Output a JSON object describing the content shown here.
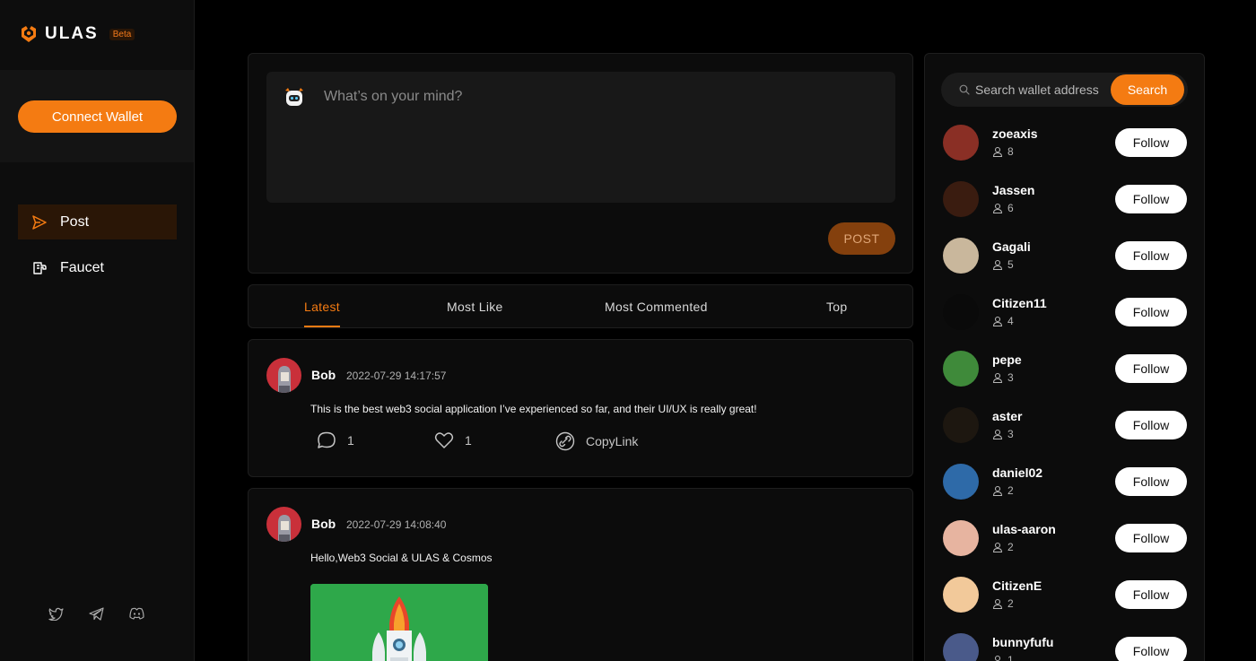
{
  "brand": {
    "name": "ULAS",
    "badge": "Beta",
    "accent": "#f47b12"
  },
  "sidebar": {
    "connect_label": "Connect Wallet",
    "nav": [
      {
        "label": "Post",
        "icon": "send-icon",
        "active": true
      },
      {
        "label": "Faucet",
        "icon": "faucet-icon",
        "active": false
      }
    ],
    "socials": [
      "twitter-icon",
      "telegram-icon",
      "discord-icon"
    ]
  },
  "composer": {
    "placeholder": "What’s on your mind?",
    "post_label": "POST"
  },
  "tabs": [
    "Latest",
    "Most Like",
    "Most Commented",
    "Top"
  ],
  "posts": [
    {
      "author": "Bob",
      "time": "2022-07-29 14:17:57",
      "text": "This is the best web3 social application I’ve experienced so far, and their UI/UX is really great!",
      "comments": "1",
      "likes": "1",
      "copy_label": "CopyLink"
    },
    {
      "author": "Bob",
      "time": "2022-07-29 14:08:40",
      "text": "Hello,Web3 Social & ULAS & Cosmos"
    }
  ],
  "search": {
    "placeholder": "Search wallet address",
    "button": "Search"
  },
  "follow_label": "Follow",
  "users": [
    {
      "name": "zoeaxis",
      "count": "8",
      "color": "#8a2f25"
    },
    {
      "name": "Jassen",
      "count": "6",
      "color": "#3a1c10"
    },
    {
      "name": "Gagali",
      "count": "5",
      "color": "#c9b79c"
    },
    {
      "name": "Citizen11",
      "count": "4",
      "color": "#0a0a0a"
    },
    {
      "name": "pepe",
      "count": "3",
      "color": "#3f8a3a"
    },
    {
      "name": "aster",
      "count": "3",
      "color": "#1d1710"
    },
    {
      "name": "daniel02",
      "count": "2",
      "color": "#2e6aa8"
    },
    {
      "name": "ulas-aaron",
      "count": "2",
      "color": "#e7b4a0"
    },
    {
      "name": "CitizenE",
      "count": "2",
      "color": "#f2c99a"
    },
    {
      "name": "bunnyfufu",
      "count": "1",
      "color": "#4a5a8a"
    }
  ]
}
